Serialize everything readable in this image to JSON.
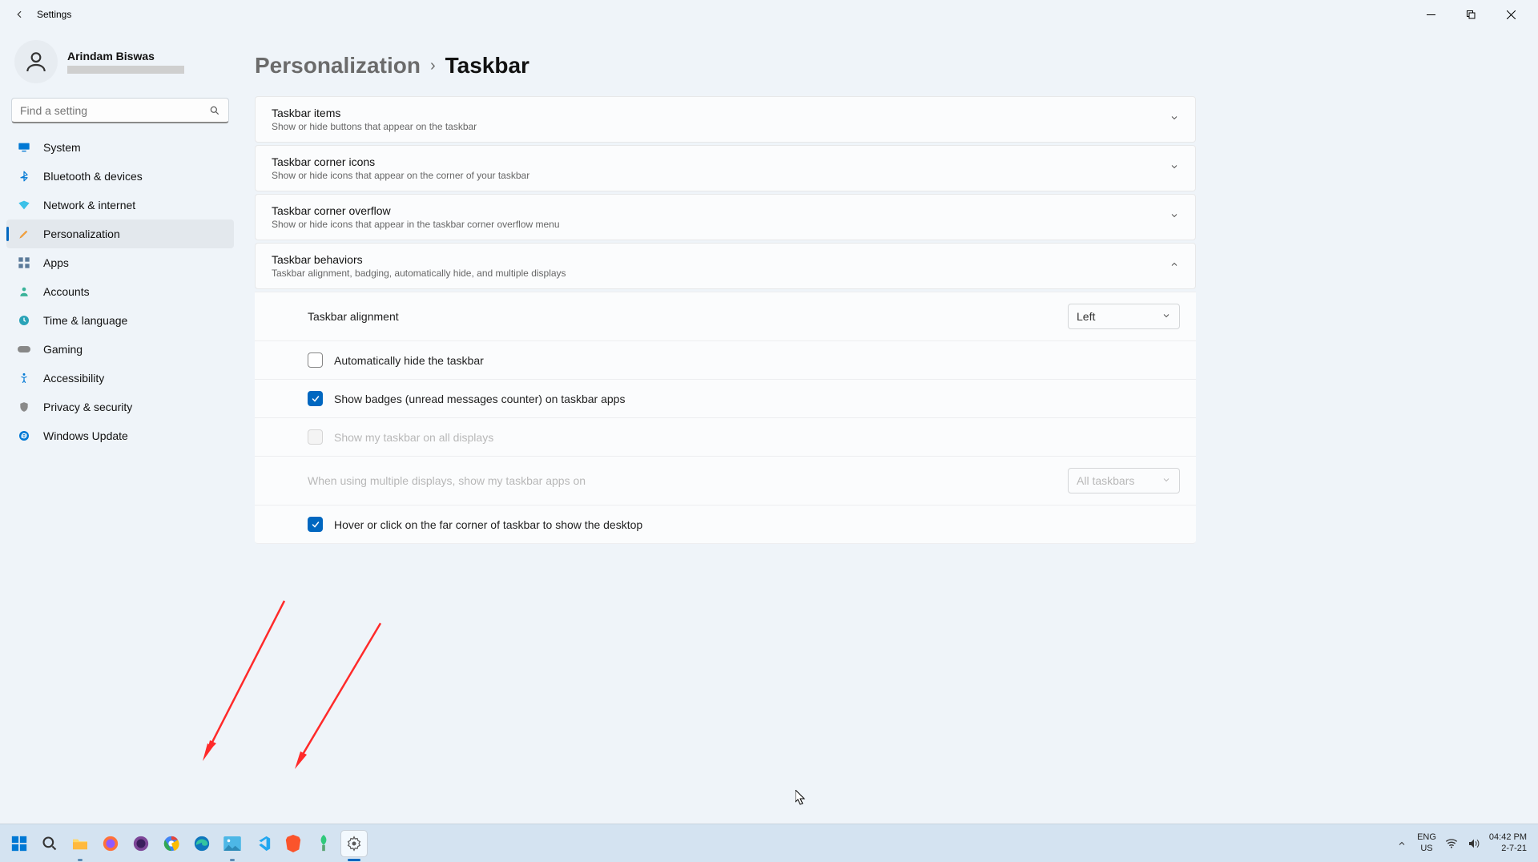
{
  "app_title": "Settings",
  "user": {
    "name": "Arindam Biswas"
  },
  "search": {
    "placeholder": "Find a setting"
  },
  "nav": {
    "system": "System",
    "bluetooth": "Bluetooth & devices",
    "network": "Network & internet",
    "personalization": "Personalization",
    "apps": "Apps",
    "accounts": "Accounts",
    "time": "Time & language",
    "gaming": "Gaming",
    "accessibility": "Accessibility",
    "privacy": "Privacy & security",
    "update": "Windows Update"
  },
  "breadcrumb": {
    "parent": "Personalization",
    "current": "Taskbar"
  },
  "cards": {
    "items": {
      "title": "Taskbar items",
      "sub": "Show or hide buttons that appear on the taskbar"
    },
    "corner_icons": {
      "title": "Taskbar corner icons",
      "sub": "Show or hide icons that appear on the corner of your taskbar"
    },
    "overflow": {
      "title": "Taskbar corner overflow",
      "sub": "Show or hide icons that appear in the taskbar corner overflow menu"
    },
    "behaviors": {
      "title": "Taskbar behaviors",
      "sub": "Taskbar alignment, badging, automatically hide, and multiple displays"
    }
  },
  "behaviors": {
    "alignment_label": "Taskbar alignment",
    "alignment_value": "Left",
    "auto_hide": "Automatically hide the taskbar",
    "badges": "Show badges (unread messages counter) on taskbar apps",
    "all_displays": "Show my taskbar on all displays",
    "multi_label": "When using multiple displays, show my taskbar apps on",
    "multi_value": "All taskbars",
    "hover_corner": "Hover or click on the far corner of taskbar to show the desktop"
  },
  "tray": {
    "lang1": "ENG",
    "lang2": "US",
    "time": "04:42 PM",
    "date": "2-7-21"
  }
}
